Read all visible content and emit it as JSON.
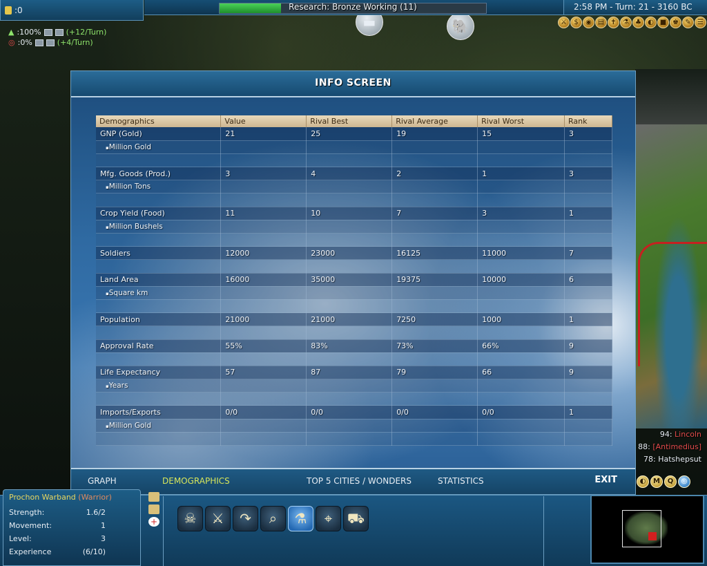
{
  "top_left": {
    "gold": ":0"
  },
  "research": {
    "label": "Research: Bronze Working (11)",
    "progress": 0.23
  },
  "status": {
    "time_turn": "2:58 PM - Turn: 21 - 3160 BC"
  },
  "rates": {
    "science_pct": ":100%",
    "science_delta": "(+12/Turn)",
    "culture_pct": ":0%",
    "culture_delta": "(+4/Turn)"
  },
  "info_screen": {
    "title": "INFO SCREEN",
    "columns": [
      "Demographics",
      "Value",
      "Rival Best",
      "Rival Average",
      "Rival Worst",
      "Rank"
    ],
    "rows": [
      {
        "kind": "main",
        "cells": [
          "GNP (Gold)",
          "21",
          "25",
          "19",
          "15",
          "3"
        ]
      },
      {
        "kind": "sub",
        "cells": [
          "Million Gold",
          "",
          "",
          "",
          "",
          ""
        ]
      },
      {
        "kind": "blank",
        "cells": [
          "",
          "",
          "",
          "",
          "",
          ""
        ]
      },
      {
        "kind": "main",
        "cells": [
          "Mfg. Goods (Prod.)",
          "3",
          "4",
          "2",
          "1",
          "3"
        ]
      },
      {
        "kind": "sub",
        "cells": [
          "Million Tons",
          "",
          "",
          "",
          "",
          ""
        ]
      },
      {
        "kind": "blank",
        "cells": [
          "",
          "",
          "",
          "",
          "",
          ""
        ]
      },
      {
        "kind": "main",
        "cells": [
          "Crop Yield (Food)",
          "11",
          "10",
          "7",
          "3",
          "1"
        ]
      },
      {
        "kind": "sub",
        "cells": [
          "Million Bushels",
          "",
          "",
          "",
          "",
          ""
        ]
      },
      {
        "kind": "blank",
        "cells": [
          "",
          "",
          "",
          "",
          "",
          ""
        ]
      },
      {
        "kind": "main",
        "cells": [
          "Soldiers",
          "12000",
          "23000",
          "16125",
          "11000",
          "7"
        ]
      },
      {
        "kind": "blank",
        "cells": [
          "",
          "",
          "",
          "",
          "",
          ""
        ]
      },
      {
        "kind": "main",
        "cells": [
          "Land Area",
          "16000",
          "35000",
          "19375",
          "10000",
          "6"
        ]
      },
      {
        "kind": "sub",
        "cells": [
          "Square km",
          "",
          "",
          "",
          "",
          ""
        ]
      },
      {
        "kind": "blank",
        "cells": [
          "",
          "",
          "",
          "",
          "",
          ""
        ]
      },
      {
        "kind": "main",
        "cells": [
          "Population",
          "21000",
          "21000",
          "7250",
          "1000",
          "1"
        ]
      },
      {
        "kind": "blank",
        "cells": [
          "",
          "",
          "",
          "",
          "",
          ""
        ]
      },
      {
        "kind": "main",
        "cells": [
          "Approval Rate",
          "55%",
          "83%",
          "73%",
          "66%",
          "9"
        ]
      },
      {
        "kind": "blank",
        "cells": [
          "",
          "",
          "",
          "",
          "",
          ""
        ]
      },
      {
        "kind": "main",
        "cells": [
          "Life Expectancy",
          "57",
          "87",
          "79",
          "66",
          "9"
        ]
      },
      {
        "kind": "sub",
        "cells": [
          "Years",
          "",
          "",
          "",
          "",
          ""
        ]
      },
      {
        "kind": "blank",
        "cells": [
          "",
          "",
          "",
          "",
          "",
          ""
        ]
      },
      {
        "kind": "main",
        "cells": [
          "Imports/Exports",
          "0/0",
          "0/0",
          "0/0",
          "0/0",
          "1"
        ]
      },
      {
        "kind": "sub",
        "cells": [
          "Million Gold",
          "",
          "",
          "",
          "",
          ""
        ]
      },
      {
        "kind": "blank",
        "cells": [
          "",
          "",
          "",
          "",
          "",
          ""
        ]
      }
    ],
    "tabs": {
      "graph": "GRAPH",
      "demographics": "DEMOGRAPHICS",
      "top5": "TOP 5 CITIES / WONDERS",
      "statistics": "STATISTICS",
      "exit": "EXIT"
    }
  },
  "leaderboard": [
    {
      "score": "94:",
      "name": "Lincoln",
      "color": "#e34b4b"
    },
    {
      "score": "88:",
      "name": "[Antimedius]",
      "color": "#e34b4b"
    },
    {
      "score": "78:",
      "name": "Hatshepsut",
      "color": "#ffffff"
    }
  ],
  "unit": {
    "name": "Prochon Warband",
    "class": "(Warrior)",
    "strength_label": "Strength:",
    "strength_value": "1.6/2",
    "movement_label": "Movement:",
    "movement_value": "1",
    "level_label": "Level:",
    "level_value": "3",
    "experience_label": "Experience",
    "experience_value": "(6/10)"
  },
  "actions": [
    {
      "icon": "skull-icon",
      "glyph": "☠"
    },
    {
      "icon": "crossed-swords-icon",
      "glyph": "⚔"
    },
    {
      "icon": "return-arrow-icon",
      "glyph": "↷"
    },
    {
      "icon": "spyglass-icon",
      "glyph": "⌕"
    },
    {
      "icon": "potion-icon",
      "glyph": "⚗",
      "selected": true
    },
    {
      "icon": "map-route-icon",
      "glyph": "⌖"
    },
    {
      "icon": "cart-icon",
      "glyph": "⛟"
    }
  ],
  "colors": {
    "accent": "#d8e65a",
    "panel_blue": "#1d5d86",
    "research_green": "#2fb23f",
    "rival_red": "#e34b4b"
  }
}
